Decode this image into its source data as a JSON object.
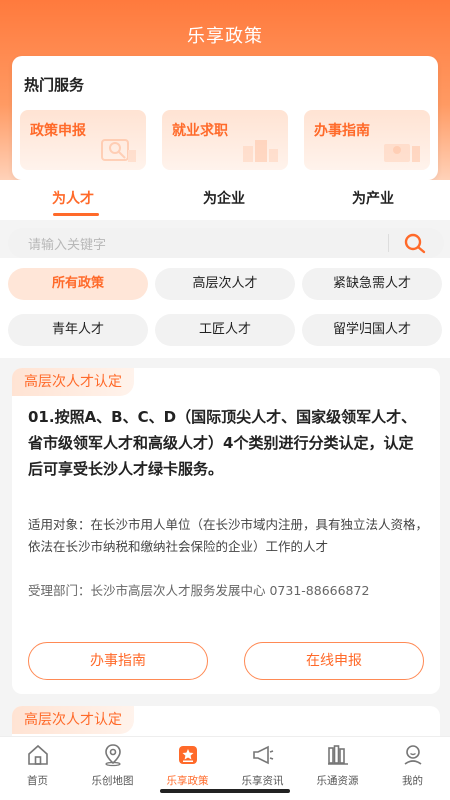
{
  "header": {
    "title": "乐享政策"
  },
  "hot_services": {
    "title": "热门服务",
    "items": [
      {
        "label": "政策申报",
        "icon": "search-person-icon"
      },
      {
        "label": "就业求职",
        "icon": "buildings-icon"
      },
      {
        "label": "办事指南",
        "icon": "person-desk-icon"
      }
    ]
  },
  "tabs": [
    {
      "label": "为人才",
      "active": true
    },
    {
      "label": "为企业",
      "active": false
    },
    {
      "label": "为产业",
      "active": false
    }
  ],
  "search": {
    "placeholder": "请输入关键字"
  },
  "filters": [
    {
      "label": "所有政策",
      "active": true
    },
    {
      "label": "高层次人才",
      "active": false
    },
    {
      "label": "紧缺急需人才",
      "active": false
    },
    {
      "label": "青年人才",
      "active": false
    },
    {
      "label": "工匠人才",
      "active": false
    },
    {
      "label": "留学归国人才",
      "active": false
    }
  ],
  "cards": [
    {
      "tag": "高层次人才认定",
      "heading": "01.按照A、B、C、D（国际顶尖人才、国家级领军人才、省市级领军人才和高级人才）4个类别进行分类认定，认定后可享受长沙人才绿卡服务。",
      "target": "适用对象：在长沙市用人单位（在长沙市域内注册，具有独立法人资格，依法在长沙市纳税和缴纳社会保险的企业）工作的人才",
      "dept": "受理部门：长沙市高层次人才服务发展中心 0731-88666872",
      "btn_guide": "办事指南",
      "btn_apply": "在线申报"
    },
    {
      "tag": "高层次人才认定"
    }
  ],
  "tabbar": [
    {
      "label": "首页",
      "icon": "home-icon",
      "active": false
    },
    {
      "label": "乐创地图",
      "icon": "map-pin-icon",
      "active": false
    },
    {
      "label": "乐享政策",
      "icon": "policy-icon",
      "active": true
    },
    {
      "label": "乐享资讯",
      "icon": "megaphone-icon",
      "active": false
    },
    {
      "label": "乐通资源",
      "icon": "books-icon",
      "active": false
    },
    {
      "label": "我的",
      "icon": "user-icon",
      "active": false
    }
  ],
  "colors": {
    "accent": "#ff6a2a",
    "header_top": "#ff7a3d",
    "chip_bg": "#f2f2f2"
  }
}
